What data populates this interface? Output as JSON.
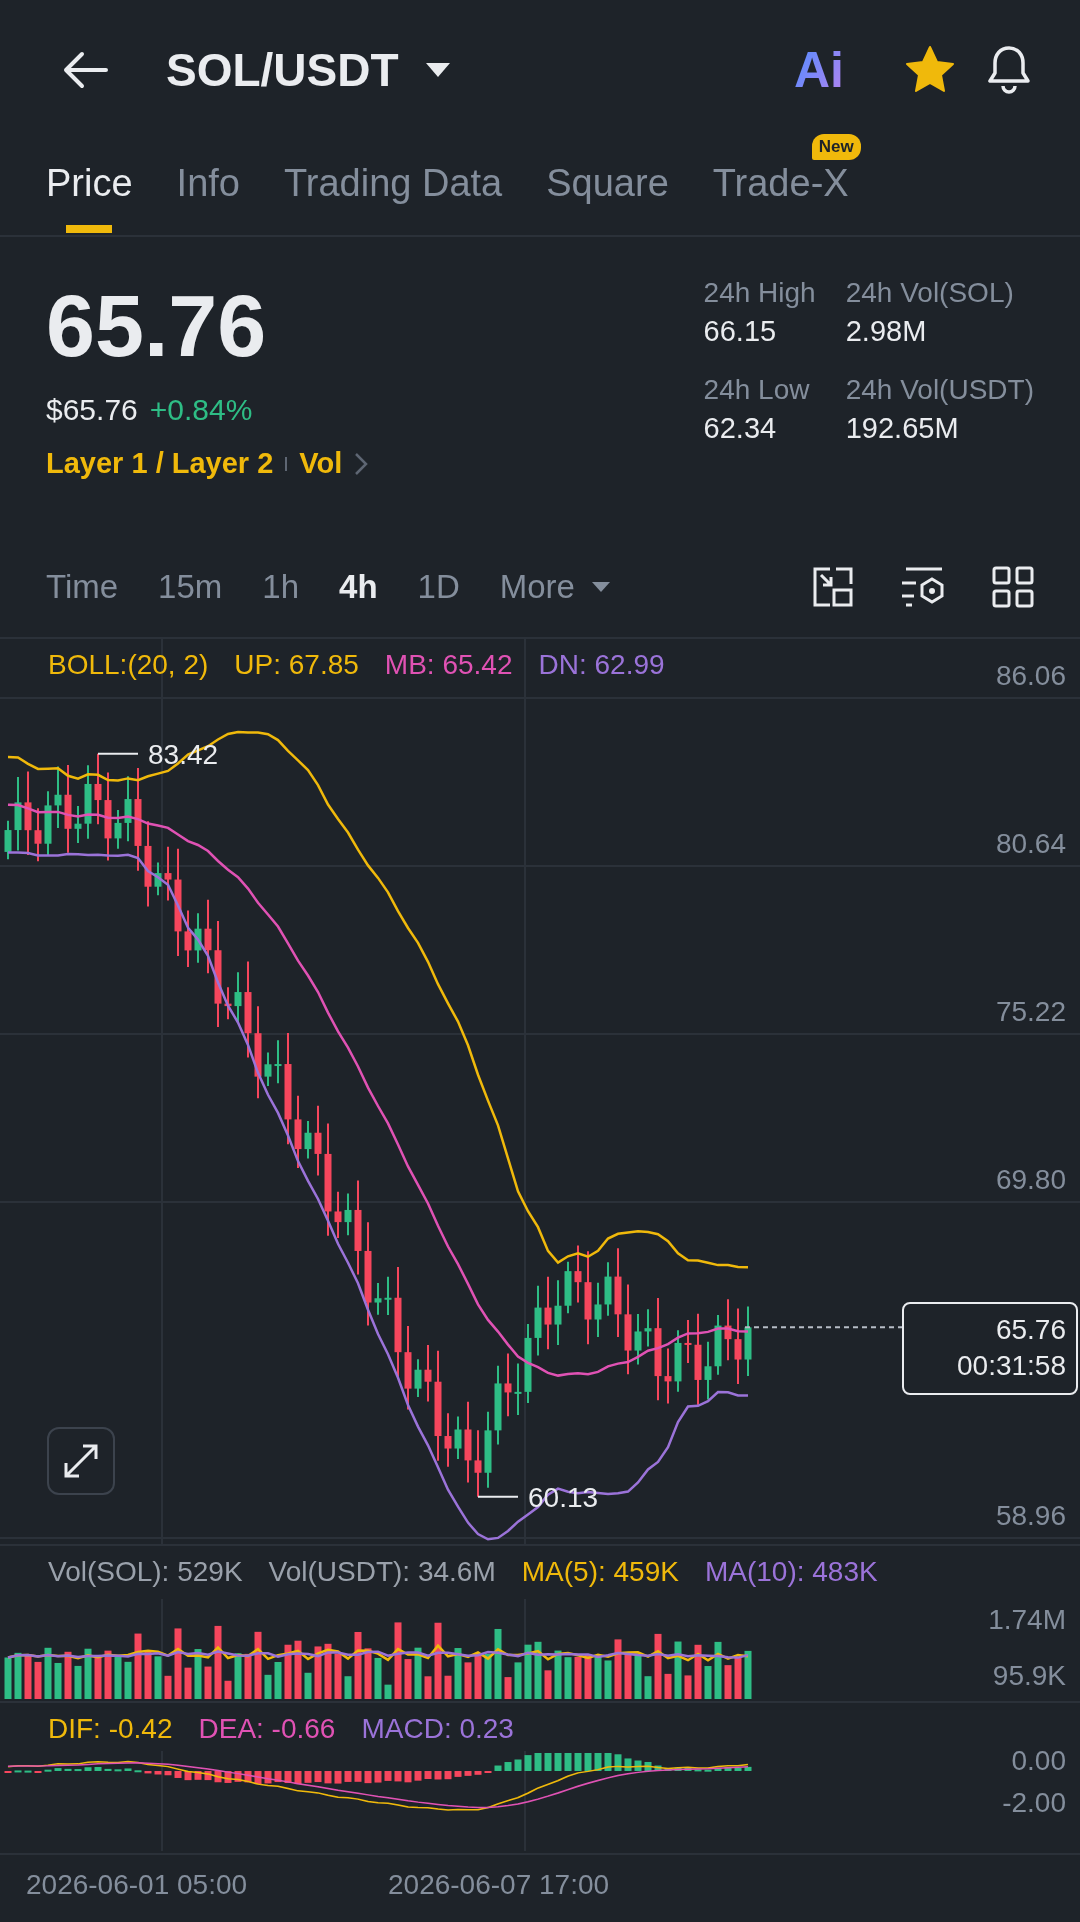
{
  "header": {
    "pair": "SOL/USDT",
    "ai_label": "Ai",
    "favorite": true
  },
  "tabs": [
    {
      "label": "Price",
      "selected": true
    },
    {
      "label": "Info",
      "selected": false
    },
    {
      "label": "Trading Data",
      "selected": false
    },
    {
      "label": "Square",
      "selected": false
    },
    {
      "label": "Trade-X",
      "selected": false,
      "badge": "New"
    }
  ],
  "price": {
    "last": "65.76",
    "usd": "$65.76",
    "change": "+0.84%",
    "tags": [
      "Layer 1 / Layer 2",
      "Vol"
    ]
  },
  "stats": [
    {
      "label": "24h High",
      "value": "66.15"
    },
    {
      "label": "24h Vol(SOL)",
      "value": "2.98M"
    },
    {
      "label": "24h Low",
      "value": "62.34"
    },
    {
      "label": "24h Vol(USDT)",
      "value": "192.65M"
    }
  ],
  "intervals": [
    {
      "label": "Time",
      "kind": "option",
      "selected": false
    },
    {
      "label": "15m",
      "kind": "option",
      "selected": false
    },
    {
      "label": "1h",
      "kind": "option",
      "selected": false
    },
    {
      "label": "4h",
      "kind": "option",
      "selected": true
    },
    {
      "label": "1D",
      "kind": "option",
      "selected": false
    },
    {
      "label": "More",
      "kind": "dropdown",
      "selected": false
    }
  ],
  "chart": {
    "legend": [
      {
        "label": "BOLL:(20, 2)",
        "color": "#f0b90b"
      },
      {
        "label": "UP: 67.85",
        "color": "#f0b90b"
      },
      {
        "label": "MB: 65.42",
        "color": "#e052b4"
      },
      {
        "label": "DN: 62.99",
        "color": "#9b73d9"
      }
    ],
    "y_labels": [
      "86.06",
      "80.64",
      "75.22",
      "69.80",
      "58.96"
    ],
    "high_label": "83.42",
    "low_label": "60.13",
    "price_tag": {
      "price": "65.76",
      "countdown": "00:31:58"
    }
  },
  "volume": {
    "legend": [
      {
        "label": "Vol(SOL): 529K",
        "color": "#9aa1ab"
      },
      {
        "label": "Vol(USDT): 34.6M",
        "color": "#9aa1ab"
      },
      {
        "label": "MA(5): 459K",
        "color": "#f0b90b"
      },
      {
        "label": "MA(10): 483K",
        "color": "#9b73d9"
      }
    ],
    "y_labels": [
      "1.74M",
      "95.9K"
    ]
  },
  "macd": {
    "legend": [
      {
        "label": "DIF: -0.42",
        "color": "#f0b90b"
      },
      {
        "label": "DEA: -0.66",
        "color": "#e052b4"
      },
      {
        "label": "MACD: 0.23",
        "color": "#9b73d9"
      }
    ],
    "y_labels": [
      "0.00",
      "-2.00"
    ]
  },
  "x_labels": [
    "2026-06-01 05:00",
    "2026-06-07 17:00"
  ]
}
